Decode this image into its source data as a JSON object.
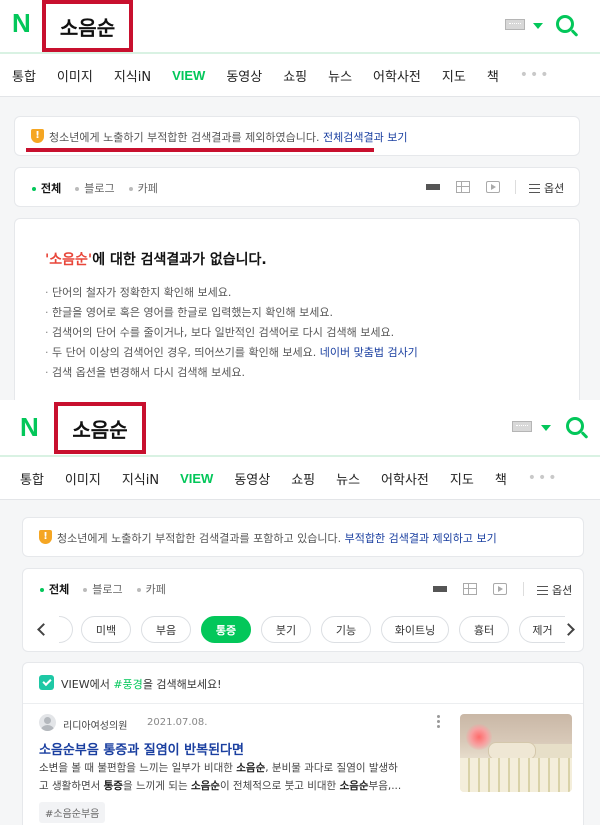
{
  "logo": "N",
  "top": {
    "query": "소음순",
    "tabs": [
      "통합",
      "이미지",
      "지식iN",
      "VIEW",
      "동영상",
      "쇼핑",
      "뉴스",
      "어학사전",
      "지도",
      "책"
    ],
    "notice_text": "청소년에게 노출하기 부적합한 검색결과를 제외하였습니다.",
    "notice_link": "전체검색결과 보기",
    "filters": [
      "전체",
      "블로그",
      "카페"
    ],
    "options_label": "옵션",
    "no_result": {
      "query_quoted": "'소음순'",
      "title_suffix": "에 대한 검색결과가 없습니다.",
      "tips": [
        "단어의 철자가 정확한지 확인해 보세요.",
        "한글을 영어로 혹은 영어를 한글로 입력했는지 확인해 보세요.",
        "검색어의 단어 수를 줄이거나, 보다 일반적인 검색어로 다시 검색해 보세요.",
        "두 단어 이상의 검색어인 경우, 띄어쓰기를 확인해 보세요.",
        "검색 옵션을 변경해서 다시 검색해 보세요."
      ],
      "tip_link": "네이버 맞춤법 검사기"
    }
  },
  "bottom": {
    "query": "소음순",
    "tabs": [
      "통합",
      "이미지",
      "지식iN",
      "VIEW",
      "동영상",
      "쇼핑",
      "뉴스",
      "어학사전",
      "지도",
      "책"
    ],
    "notice_text": "청소년에게 노출하기 부적합한 검색결과를 포함하고 있습니다.",
    "notice_link": "부적합한 검색결과 제외하고 보기",
    "filters": [
      "전체",
      "블로그",
      "카페"
    ],
    "options_label": "옵션",
    "chips": [
      "미백",
      "부음",
      "통증",
      "붓기",
      "기능",
      "화이트닝",
      "흉터",
      "제거"
    ],
    "active_chip": "통증",
    "suggest_prefix": "VIEW에서 ",
    "suggest_tag": "#풍경",
    "suggest_suffix": "을 검색해보세요!",
    "post": {
      "author": "리디아여성의원",
      "date": "2021.07.08.",
      "title_a": "소음순",
      "title_b": "부음 ",
      "title_c": "통증",
      "title_d": "과 질염이 반복된다면",
      "snippet_line1_a": "소변을 볼 때 불편함을 느끼는 일부가 비대한 ",
      "snippet_line1_b": "소음순",
      "snippet_line1_c": ", 분비물 과다로 질염이 발생하",
      "snippet_line2_a": "고 생활하면서 ",
      "snippet_line2_b": "통증",
      "snippet_line2_c": "을 느끼게 되는 ",
      "snippet_line2_d": "소음순",
      "snippet_line2_e": "이 전체적으로 붓고 비대한 ",
      "snippet_line2_f": "소음순",
      "snippet_line2_g": "부음,...",
      "hashtag": "#소음순부음"
    }
  },
  "colors": {
    "brand": "#03c75a",
    "highlight": "#c8102e",
    "link": "#1a3fa0",
    "warning": "#f5a623"
  }
}
